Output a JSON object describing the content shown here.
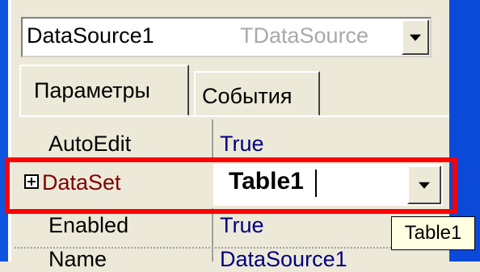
{
  "component_selector": {
    "name": "DataSource1",
    "type": "TDataSource"
  },
  "tabs": [
    {
      "label": "Параметры",
      "active": true
    },
    {
      "label": "События",
      "active": false
    }
  ],
  "properties": [
    {
      "name": "AutoEdit",
      "value": "True"
    },
    {
      "name": "DataSet",
      "value": "Table1",
      "expandable": true,
      "selected": true
    },
    {
      "name": "Enabled",
      "value": "True"
    },
    {
      "name": "Name",
      "value": "DataSource1"
    }
  ],
  "tooltip": "Table1",
  "colors": {
    "highlight": "#ff0000",
    "selected_name": "#800000",
    "value_text": "#000080",
    "background": "#ece9d8"
  }
}
